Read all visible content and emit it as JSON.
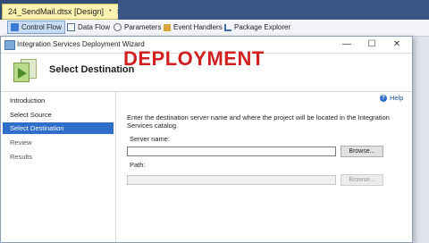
{
  "doc_tab": {
    "title": "24_SendMail.dtsx [Design]",
    "pin": "•",
    "close": "×"
  },
  "toolbar": {
    "items": [
      {
        "label": "Control Flow",
        "icon": "control-flow-icon"
      },
      {
        "label": "Data Flow",
        "icon": "data-flow-icon"
      },
      {
        "label": "Parameters",
        "icon": "parameters-icon"
      },
      {
        "label": "Event Handlers",
        "icon": "event-handlers-icon"
      },
      {
        "label": "Package Explorer",
        "icon": "package-explorer-icon"
      }
    ]
  },
  "wizard": {
    "title": "Integration Services Deployment Wizard",
    "controls": {
      "minimize": "—",
      "maximize": "☐",
      "close": "✕"
    },
    "header_title": "Select Destination",
    "nav": [
      "Introduction",
      "Select Source",
      "Select Destination",
      "Review",
      "Results"
    ],
    "selected_nav": "Select Destination",
    "overlay_text": "DEPLOYMENT",
    "help_label": "Help",
    "instructions": "Enter the destination server name and where the project will be located in the Integration Services catalog.",
    "server_label": "Server name:",
    "server_value": "",
    "path_label": "Path:",
    "path_value": "",
    "browse_label": "Browse...",
    "browse_disabled_label": "Browse..."
  },
  "colors": {
    "selected_nav": "#2f6fc9",
    "overlay": "#d21f1f",
    "tab": "#fdf3b0"
  }
}
